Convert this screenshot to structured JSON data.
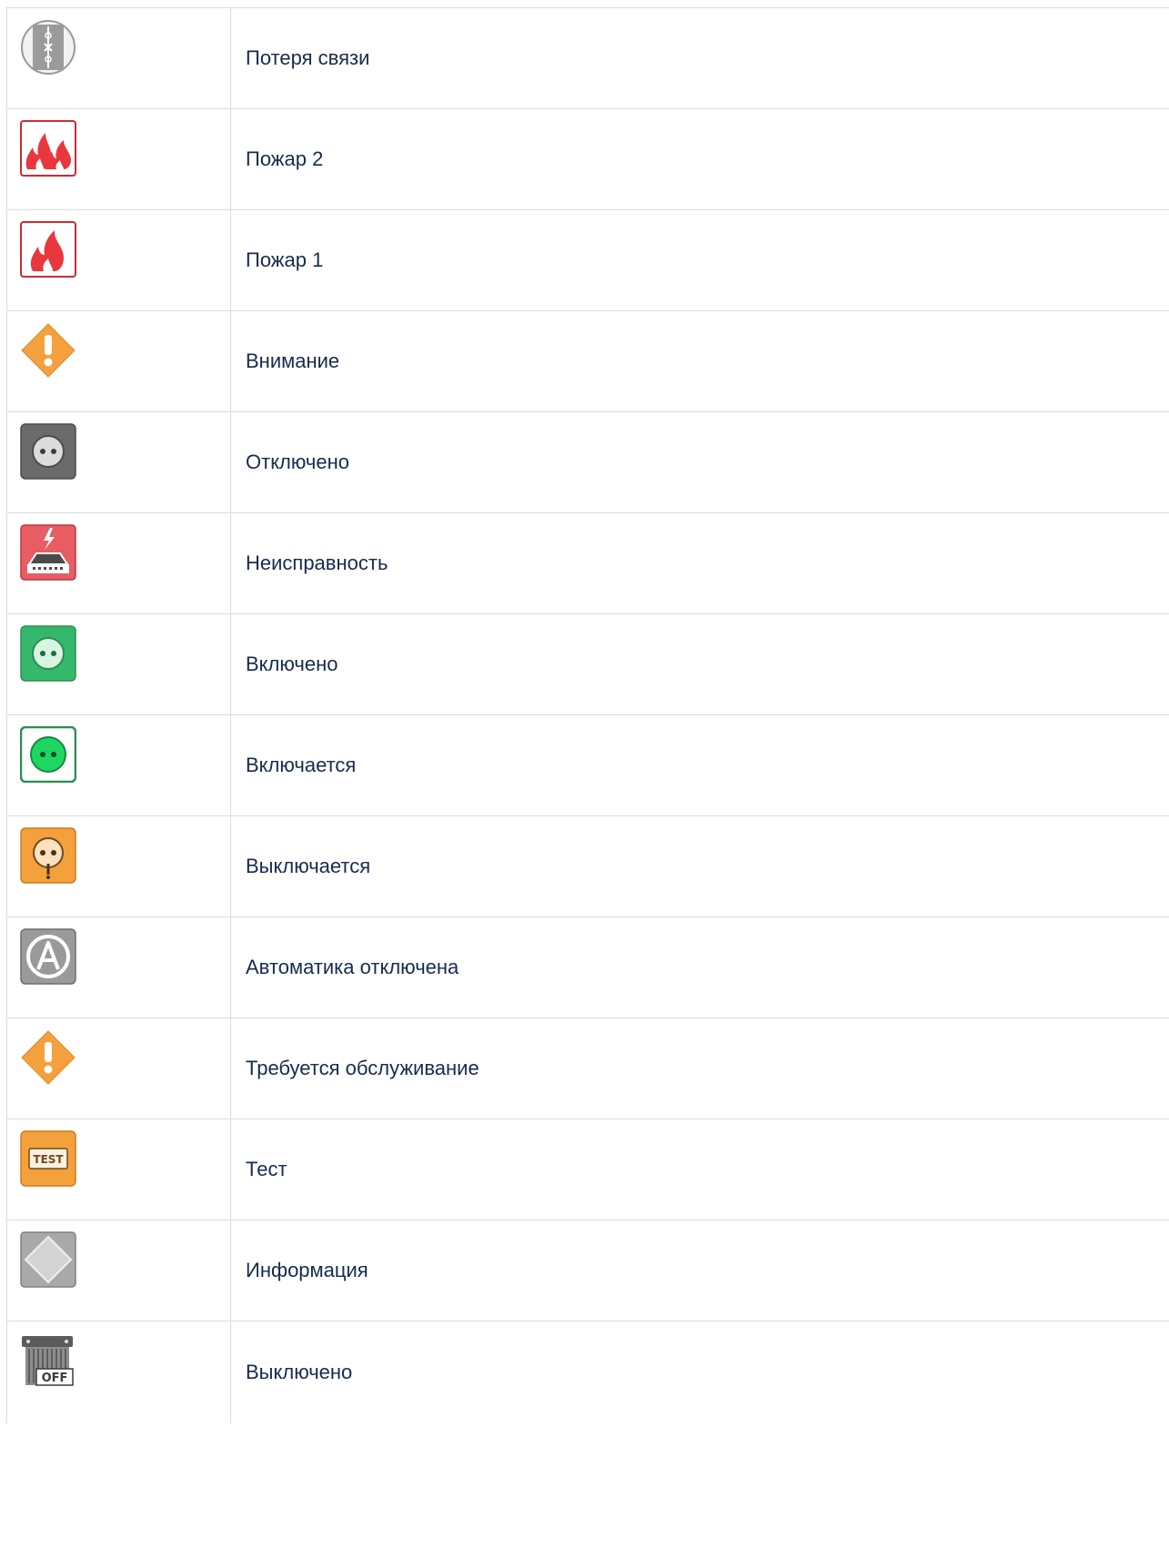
{
  "rows": [
    {
      "icon": "connection-lost-icon",
      "label": "Потеря связи"
    },
    {
      "icon": "fire-2-icon",
      "label": "Пожар 2"
    },
    {
      "icon": "fire-1-icon",
      "label": "Пожар 1"
    },
    {
      "icon": "warning-diamond-icon",
      "label": "Внимание"
    },
    {
      "icon": "socket-off-icon",
      "label": "Отключено"
    },
    {
      "icon": "malfunction-icon",
      "label": "Неисправность"
    },
    {
      "icon": "socket-on-icon",
      "label": "Включено"
    },
    {
      "icon": "socket-turning-on-icon",
      "label": "Включается"
    },
    {
      "icon": "socket-turning-off-icon",
      "label": "Выключается"
    },
    {
      "icon": "automation-disabled-icon",
      "label": "Автоматика отключена"
    },
    {
      "icon": "maintenance-required-icon",
      "label": "Требуется обслуживание"
    },
    {
      "icon": "test-icon",
      "label": "Тест"
    },
    {
      "icon": "information-icon",
      "label": "Информация"
    },
    {
      "icon": "switched-off-icon",
      "label": "Выключено"
    }
  ],
  "colors": {
    "fire": "#e8383d",
    "warning": "#f4a03c",
    "on": "#35b86b",
    "turning_on": "#1ed760",
    "off_grey": "#6b6b6b",
    "label_text": "#172b4d",
    "border": "#d9dde2"
  }
}
